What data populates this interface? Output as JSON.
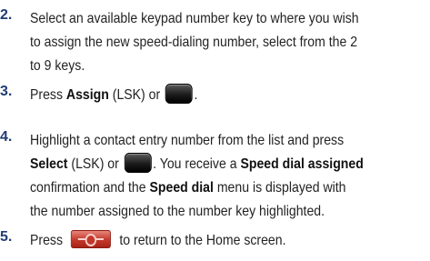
{
  "steps": [
    {
      "number": "2.",
      "lines": [
        "Select an available keypad number key to where you wish",
        "to assign the new speed-dialing number, select from the 2",
        "to 9 keys."
      ]
    },
    {
      "number": "3.",
      "pre": "Press ",
      "bold1": "Assign",
      "mid": " (LSK) or ",
      "post": "."
    },
    {
      "number": "4.",
      "line1": "Highlight a contact entry number from the list and press",
      "line2_bold1": "Select",
      "line2_mid": " (LSK) or ",
      "line2_mid2": ". You receive a ",
      "line2_bold2": "Speed dial assigned",
      "line3_pre": "confirmation and the ",
      "line3_bold": "Speed dial",
      "line3_post": " menu is displayed with",
      "line4": "the number assigned to the number key highlighted."
    },
    {
      "number": "5.",
      "pre": "Press ",
      "post": " to return to the Home screen."
    }
  ],
  "icons": {
    "ok_key": "navigation-center-key-icon",
    "end_key": "end-power-key-icon"
  },
  "colors": {
    "step_number": "#1f3d73",
    "end_key": "#c3372b",
    "ok_key": "#1c1c1c"
  }
}
